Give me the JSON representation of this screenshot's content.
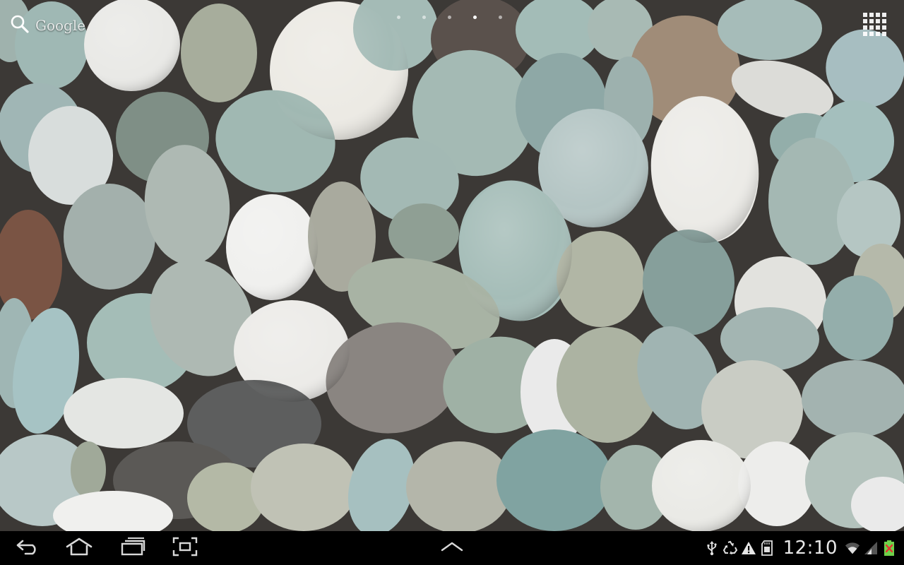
{
  "search": {
    "label": "Google",
    "icon": "search-icon"
  },
  "home_pages": {
    "count": 5,
    "active_index": 3
  },
  "apps_button": {
    "icon": "apps-grid-icon"
  },
  "navigation": {
    "back_icon": "back-icon",
    "home_icon": "home-icon",
    "recents_icon": "recent-apps-icon",
    "screenshot_icon": "screenshot-icon",
    "menu_icon": "chevron-up-icon"
  },
  "status_bar": {
    "time": "12:10",
    "icons": [
      "usb-icon",
      "recycle-icon",
      "warning-icon",
      "sd-card-icon",
      "wifi-icon",
      "signal-icon",
      "battery-icon"
    ]
  },
  "colors": {
    "system_bar": "#000000",
    "battery_fill": "#6fd14a",
    "battery_alert": "#e83030"
  }
}
